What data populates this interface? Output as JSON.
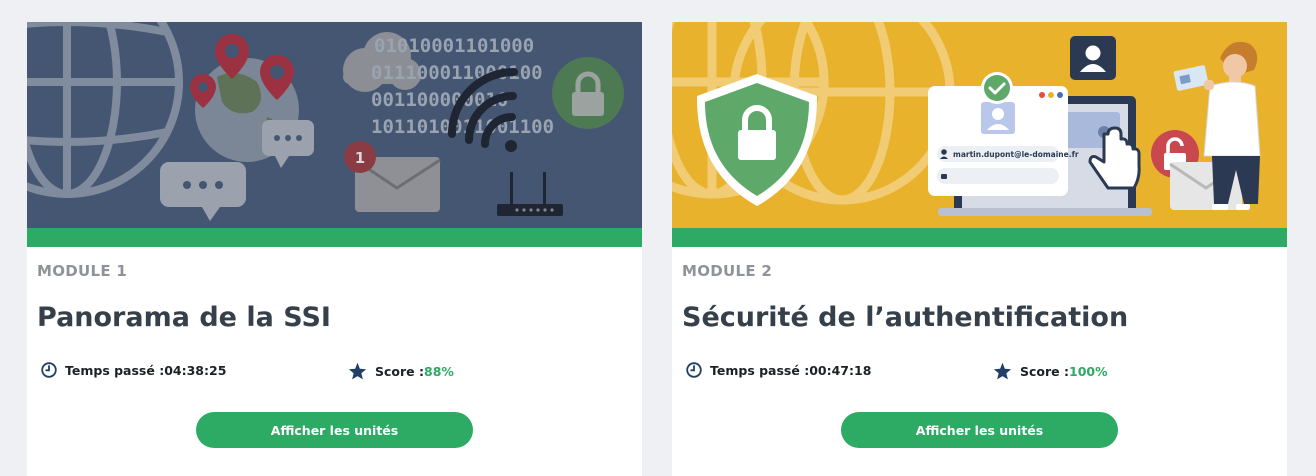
{
  "colors": {
    "accent": "#2daa63",
    "banner1_bg": "#445672",
    "banner2_bg": "#e8b22c",
    "title": "#36404b",
    "label": "#8f9399",
    "icon": "#1f3f66"
  },
  "modules": [
    {
      "label": "MODULE 1",
      "title": "Panorama de la SSI",
      "progress": 1.0,
      "time_label": "Temps passé : ",
      "time_value": "04:38:25",
      "score_label": "Score : ",
      "score_value": "88%",
      "button_label": "Afficher les unités",
      "banner": {
        "binary_rows": [
          "01010001101000",
          "011100011000100",
          "001100000010",
          "1011010011001100"
        ],
        "mail_badge": "1"
      }
    },
    {
      "label": "MODULE 2",
      "title": "Sécurité de l’authentification",
      "progress": 1.0,
      "time_label": "Temps passé : ",
      "time_value": "00:47:18",
      "score_label": "Score : ",
      "score_value": "100%",
      "button_label": "Afficher les unités",
      "banner": {
        "email": "martin.dupont@le-domaine.fr"
      }
    }
  ],
  "icons": {
    "time": "clock-icon",
    "score": "star-icon"
  }
}
